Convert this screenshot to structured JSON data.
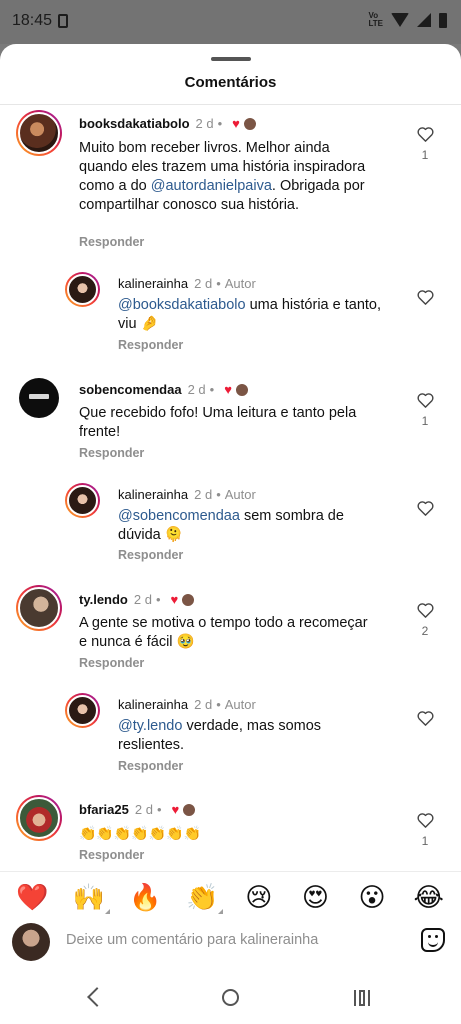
{
  "status_bar": {
    "time": "18:45",
    "network": "Vo\nLTE"
  },
  "sheet": {
    "title": "Comentários"
  },
  "comments": [
    {
      "username": "booksdakatiabolo",
      "time": "2 d",
      "author_liked": true,
      "segments": [
        "Muito bom receber livros. Melhor ainda quando eles trazem uma história inspiradora como a do ",
        "@autordanielpaiva",
        ". Obrigada por compartilhar conosco sua história."
      ],
      "reply_label": "Responder",
      "likes": "1",
      "reply": {
        "username": "kalinerainha",
        "time": "2 d",
        "dot": "•",
        "author": "Autor",
        "mention": "@booksdakatiabolo",
        "text": " uma história e tanto, viu 🤌",
        "reply_label": "Responder"
      }
    },
    {
      "username": "sobencomendaa",
      "time": "2 d",
      "author_liked": true,
      "text": "Que recebido fofo! Uma leitura e tanto pela frente!",
      "reply_label": "Responder",
      "likes": "1",
      "reply": {
        "username": "kalinerainha",
        "time": "2 d",
        "dot": "•",
        "author": "Autor",
        "mention": "@sobencomendaa",
        "text": " sem sombra de dúvida 🫠",
        "reply_label": "Responder"
      }
    },
    {
      "username": "ty.lendo",
      "time": "2 d",
      "author_liked": true,
      "text": "A gente se motiva o tempo todo a recomeçar e nunca é fácil 🥹",
      "reply_label": "Responder",
      "likes": "2",
      "reply": {
        "username": "kalinerainha",
        "time": "2 d",
        "dot": "•",
        "author": "Autor",
        "mention": "@ty.lendo",
        "text": " verdade, mas somos reslientes.",
        "reply_label": "Responder"
      }
    },
    {
      "username": "bfaria25",
      "time": "2 d",
      "author_liked": true,
      "text": "👏👏👏👏👏👏👏",
      "reply_label": "Responder",
      "likes": "1"
    }
  ],
  "quick_reactions": [
    "❤️",
    "🙌",
    "🔥",
    "👏",
    "😢",
    "😍",
    "😮",
    "😂"
  ],
  "compose": {
    "placeholder": "Deixe um comentário para kalinerainha"
  },
  "colors": {
    "like_red": "#ed1c37",
    "mention": "#2d5a8e",
    "muted": "#8e8e8e"
  }
}
